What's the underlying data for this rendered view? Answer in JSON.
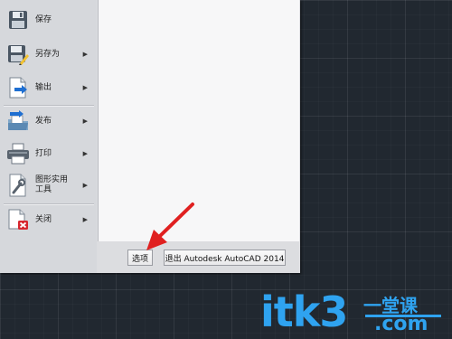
{
  "menu": {
    "items": [
      {
        "label": "保存",
        "icon": "save-icon",
        "has_submenu": false
      },
      {
        "label": "另存为",
        "icon": "save-as-icon",
        "has_submenu": true
      },
      {
        "label": "输出",
        "icon": "export-icon",
        "has_submenu": true
      },
      {
        "label": "发布",
        "icon": "publish-icon",
        "has_submenu": true
      },
      {
        "label": "打印",
        "icon": "print-icon",
        "has_submenu": true
      },
      {
        "label": "图形实用\n工具",
        "icon": "drawing-utilities-icon",
        "has_submenu": true
      },
      {
        "label": "关闭",
        "icon": "close-icon",
        "has_submenu": true
      }
    ],
    "submenu_arrow": "▶"
  },
  "footer": {
    "options_label": "选项",
    "exit_label": "退出 Autodesk AutoCAD 2014"
  },
  "watermark": {
    "main": "itk3",
    "sub": "一堂课",
    "dotcom": ".com"
  },
  "colors": {
    "canvas": "#212830",
    "panel": "#dcdde0",
    "annotation_arrow": "#e02020",
    "watermark": "#2fa3f0"
  }
}
